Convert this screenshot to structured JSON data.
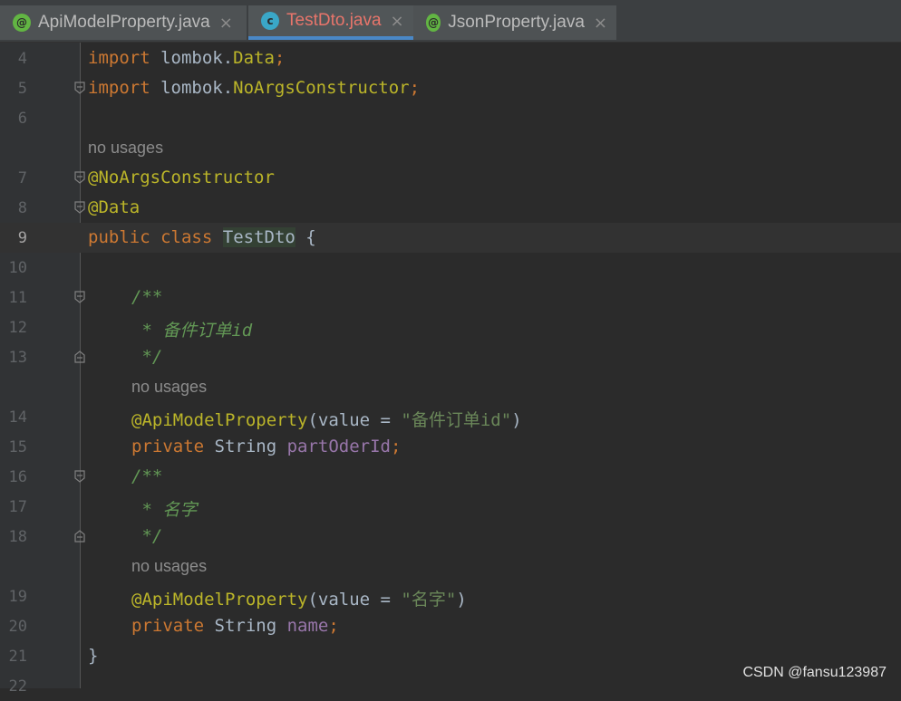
{
  "tabs": [
    {
      "label": "ApiModelProperty.java",
      "icon": "annotation-file-icon",
      "close": "×"
    },
    {
      "label": "TestDto.java",
      "icon": "class-file-icon",
      "close": "×"
    },
    {
      "label": "JsonProperty.java",
      "icon": "annotation-file-icon",
      "close": "×"
    }
  ],
  "icon_glyphs": {
    "annotation": "@",
    "class": "c"
  },
  "lines": [
    {
      "n": "4",
      "tokens": {
        "t1": "import",
        "t2": " lombok.",
        "t3": "Data",
        "t4": ";"
      }
    },
    {
      "n": "5",
      "tokens": {
        "t1": "import",
        "t2": " lombok.",
        "t3": "NoArgsConstructor",
        "t4": ";"
      }
    },
    {
      "n": "6"
    },
    {
      "hint": "no usages"
    },
    {
      "n": "7",
      "tokens": {
        "t1": "@NoArgsConstructor"
      }
    },
    {
      "n": "8",
      "tokens": {
        "t1": "@Data"
      }
    },
    {
      "n": "9",
      "tokens": {
        "t1": "public",
        "t2": " ",
        "t3": "class",
        "t4": " ",
        "t5": "TestDto",
        "t6": " {"
      }
    },
    {
      "n": "10"
    },
    {
      "n": "11",
      "tokens": {
        "t1": "/**"
      }
    },
    {
      "n": "12",
      "tokens": {
        "t1": " * 备件订单id"
      }
    },
    {
      "n": "13",
      "tokens": {
        "t1": " */"
      }
    },
    {
      "hint": "no usages"
    },
    {
      "n": "14",
      "tokens": {
        "t1": "@ApiModelProperty",
        "t2": "(value = ",
        "t3": "\"备件订单id\"",
        "t4": ")"
      }
    },
    {
      "n": "15",
      "tokens": {
        "t1": "private",
        "t2": " String ",
        "t3": "partOderId",
        "t4": ";"
      }
    },
    {
      "n": "16",
      "tokens": {
        "t1": "/**"
      }
    },
    {
      "n": "17",
      "tokens": {
        "t1": " * 名字"
      }
    },
    {
      "n": "18",
      "tokens": {
        "t1": " */"
      }
    },
    {
      "hint": "no usages"
    },
    {
      "n": "19",
      "tokens": {
        "t1": "@ApiModelProperty",
        "t2": "(value = ",
        "t3": "\"名字\"",
        "t4": ")"
      }
    },
    {
      "n": "20",
      "tokens": {
        "t1": "private",
        "t2": " String ",
        "t3": "name",
        "t4": ";"
      }
    },
    {
      "n": "21",
      "tokens": {
        "t1": "}"
      }
    },
    {
      "n": "22"
    }
  ],
  "watermark": "CSDN @fansu123987",
  "colors": {
    "keyword": "#cc7832",
    "annotation": "#bbb529",
    "string": "#6a8759",
    "field": "#9876aa",
    "doc_comment": "#629755",
    "plain": "#a9b7c6",
    "background": "#2b2b2b",
    "active_tab_text": "#e8756b",
    "active_tab_underline": "#4a88c7"
  }
}
